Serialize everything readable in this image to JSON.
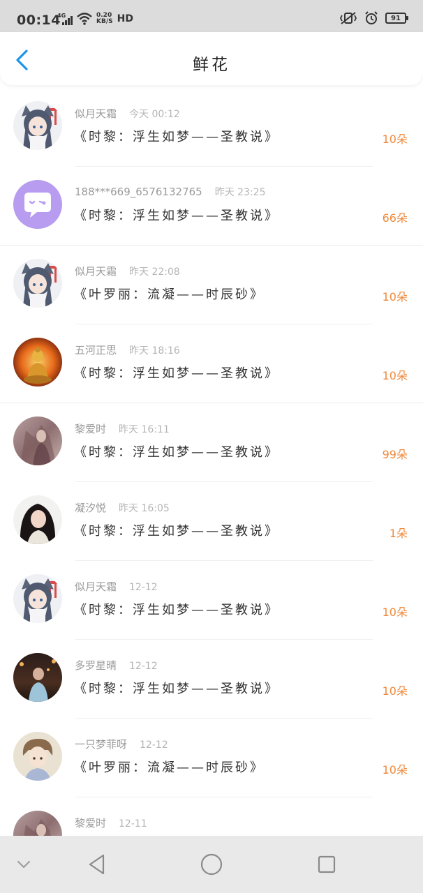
{
  "status_bar": {
    "time": "00:14",
    "network_type": "4G",
    "net_speed_value": "0.20",
    "net_speed_unit": "KB/S",
    "hd_label": "HD",
    "battery_level": "91"
  },
  "header": {
    "title": "鲜花"
  },
  "colors": {
    "accent_blue": "#1e96e6",
    "count_orange": "#f08a3c",
    "meta_gray": "#9a9a9a"
  },
  "items": [
    {
      "user": "似月天霜",
      "time": "今天 00:12",
      "novel": "《时黎：浮生如梦——圣教说》",
      "count": "10朵",
      "avatar": "anime-girl-avatar"
    },
    {
      "user": "188***669_6576132765",
      "time": "昨天 23:25",
      "novel": "《时黎：浮生如梦——圣教说》",
      "count": "66朵",
      "avatar": "default-chat-avatar"
    },
    {
      "user": "似月天霜",
      "time": "昨天 22:08",
      "novel": "《叶罗丽：流凝——时辰砂》",
      "count": "10朵",
      "avatar": "anime-girl-avatar"
    },
    {
      "user": "五河正思",
      "time": "昨天 18:16",
      "novel": "《时黎：浮生如梦——圣教说》",
      "count": "10朵",
      "avatar": "buddha-avatar"
    },
    {
      "user": "黎爱时",
      "time": "昨天 16:11",
      "novel": "《时黎：浮生如梦——圣教说》",
      "count": "99朵",
      "avatar": "painting-avatar"
    },
    {
      "user": "凝汐悦",
      "time": "昨天 16:05",
      "novel": "《时黎：浮生如梦——圣教说》",
      "count": "1朵",
      "avatar": "girl-photo-avatar"
    },
    {
      "user": "似月天霜",
      "time": "12-12",
      "novel": "《时黎：浮生如梦——圣教说》",
      "count": "10朵",
      "avatar": "anime-girl-avatar"
    },
    {
      "user": "多罗星晴",
      "time": "12-12",
      "novel": "《时黎：浮生如梦——圣教说》",
      "count": "10朵",
      "avatar": "street-photo-avatar"
    },
    {
      "user": "一只梦菲呀",
      "time": "12-12",
      "novel": "《叶罗丽：流凝——时辰砂》",
      "count": "10朵",
      "avatar": "anime-boy-avatar"
    },
    {
      "user": "黎爱时",
      "time": "12-11",
      "novel": "",
      "count": "",
      "avatar": "painting-avatar"
    }
  ],
  "nav_bar": {
    "icons": [
      "chevron-down-icon",
      "back-triangle-icon",
      "home-circle-icon",
      "recents-square-icon"
    ]
  }
}
